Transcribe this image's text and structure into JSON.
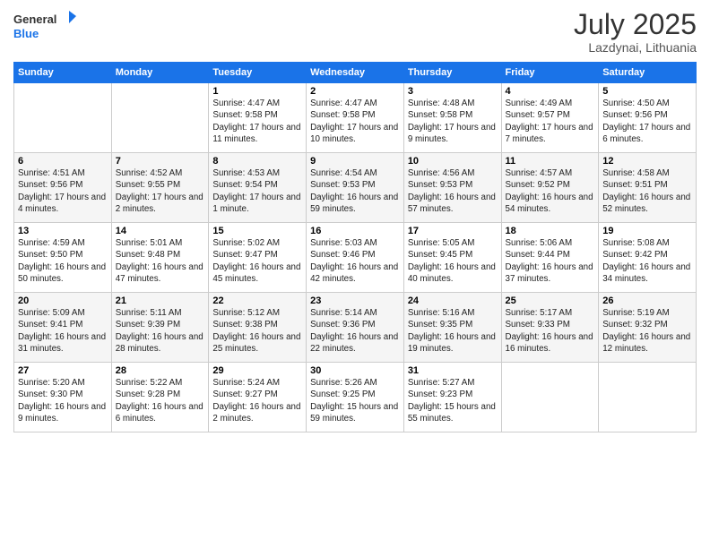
{
  "header": {
    "logo_general": "General",
    "logo_blue": "Blue",
    "month_title": "July 2025",
    "location": "Lazdynai, Lithuania"
  },
  "days_of_week": [
    "Sunday",
    "Monday",
    "Tuesday",
    "Wednesday",
    "Thursday",
    "Friday",
    "Saturday"
  ],
  "weeks": [
    [
      {
        "day": "",
        "info": ""
      },
      {
        "day": "",
        "info": ""
      },
      {
        "day": "1",
        "info": "Sunrise: 4:47 AM\nSunset: 9:58 PM\nDaylight: 17 hours and 11 minutes."
      },
      {
        "day": "2",
        "info": "Sunrise: 4:47 AM\nSunset: 9:58 PM\nDaylight: 17 hours and 10 minutes."
      },
      {
        "day": "3",
        "info": "Sunrise: 4:48 AM\nSunset: 9:58 PM\nDaylight: 17 hours and 9 minutes."
      },
      {
        "day": "4",
        "info": "Sunrise: 4:49 AM\nSunset: 9:57 PM\nDaylight: 17 hours and 7 minutes."
      },
      {
        "day": "5",
        "info": "Sunrise: 4:50 AM\nSunset: 9:56 PM\nDaylight: 17 hours and 6 minutes."
      }
    ],
    [
      {
        "day": "6",
        "info": "Sunrise: 4:51 AM\nSunset: 9:56 PM\nDaylight: 17 hours and 4 minutes."
      },
      {
        "day": "7",
        "info": "Sunrise: 4:52 AM\nSunset: 9:55 PM\nDaylight: 17 hours and 2 minutes."
      },
      {
        "day": "8",
        "info": "Sunrise: 4:53 AM\nSunset: 9:54 PM\nDaylight: 17 hours and 1 minute."
      },
      {
        "day": "9",
        "info": "Sunrise: 4:54 AM\nSunset: 9:53 PM\nDaylight: 16 hours and 59 minutes."
      },
      {
        "day": "10",
        "info": "Sunrise: 4:56 AM\nSunset: 9:53 PM\nDaylight: 16 hours and 57 minutes."
      },
      {
        "day": "11",
        "info": "Sunrise: 4:57 AM\nSunset: 9:52 PM\nDaylight: 16 hours and 54 minutes."
      },
      {
        "day": "12",
        "info": "Sunrise: 4:58 AM\nSunset: 9:51 PM\nDaylight: 16 hours and 52 minutes."
      }
    ],
    [
      {
        "day": "13",
        "info": "Sunrise: 4:59 AM\nSunset: 9:50 PM\nDaylight: 16 hours and 50 minutes."
      },
      {
        "day": "14",
        "info": "Sunrise: 5:01 AM\nSunset: 9:48 PM\nDaylight: 16 hours and 47 minutes."
      },
      {
        "day": "15",
        "info": "Sunrise: 5:02 AM\nSunset: 9:47 PM\nDaylight: 16 hours and 45 minutes."
      },
      {
        "day": "16",
        "info": "Sunrise: 5:03 AM\nSunset: 9:46 PM\nDaylight: 16 hours and 42 minutes."
      },
      {
        "day": "17",
        "info": "Sunrise: 5:05 AM\nSunset: 9:45 PM\nDaylight: 16 hours and 40 minutes."
      },
      {
        "day": "18",
        "info": "Sunrise: 5:06 AM\nSunset: 9:44 PM\nDaylight: 16 hours and 37 minutes."
      },
      {
        "day": "19",
        "info": "Sunrise: 5:08 AM\nSunset: 9:42 PM\nDaylight: 16 hours and 34 minutes."
      }
    ],
    [
      {
        "day": "20",
        "info": "Sunrise: 5:09 AM\nSunset: 9:41 PM\nDaylight: 16 hours and 31 minutes."
      },
      {
        "day": "21",
        "info": "Sunrise: 5:11 AM\nSunset: 9:39 PM\nDaylight: 16 hours and 28 minutes."
      },
      {
        "day": "22",
        "info": "Sunrise: 5:12 AM\nSunset: 9:38 PM\nDaylight: 16 hours and 25 minutes."
      },
      {
        "day": "23",
        "info": "Sunrise: 5:14 AM\nSunset: 9:36 PM\nDaylight: 16 hours and 22 minutes."
      },
      {
        "day": "24",
        "info": "Sunrise: 5:16 AM\nSunset: 9:35 PM\nDaylight: 16 hours and 19 minutes."
      },
      {
        "day": "25",
        "info": "Sunrise: 5:17 AM\nSunset: 9:33 PM\nDaylight: 16 hours and 16 minutes."
      },
      {
        "day": "26",
        "info": "Sunrise: 5:19 AM\nSunset: 9:32 PM\nDaylight: 16 hours and 12 minutes."
      }
    ],
    [
      {
        "day": "27",
        "info": "Sunrise: 5:20 AM\nSunset: 9:30 PM\nDaylight: 16 hours and 9 minutes."
      },
      {
        "day": "28",
        "info": "Sunrise: 5:22 AM\nSunset: 9:28 PM\nDaylight: 16 hours and 6 minutes."
      },
      {
        "day": "29",
        "info": "Sunrise: 5:24 AM\nSunset: 9:27 PM\nDaylight: 16 hours and 2 minutes."
      },
      {
        "day": "30",
        "info": "Sunrise: 5:26 AM\nSunset: 9:25 PM\nDaylight: 15 hours and 59 minutes."
      },
      {
        "day": "31",
        "info": "Sunrise: 5:27 AM\nSunset: 9:23 PM\nDaylight: 15 hours and 55 minutes."
      },
      {
        "day": "",
        "info": ""
      },
      {
        "day": "",
        "info": ""
      }
    ]
  ]
}
